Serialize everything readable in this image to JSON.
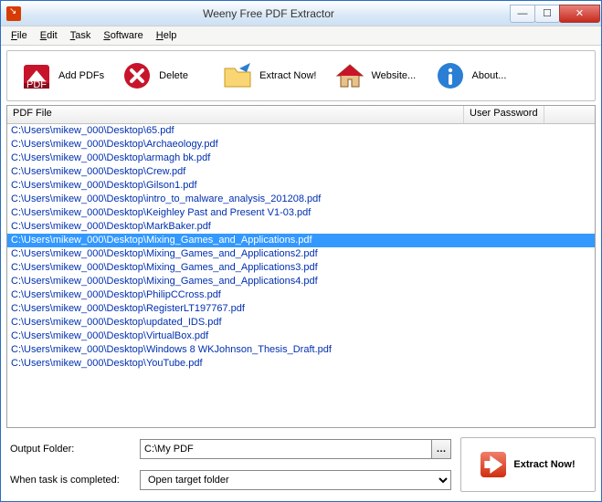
{
  "window": {
    "title": "Weeny Free PDF Extractor"
  },
  "menubar": {
    "file_suffix": "ile",
    "edit_suffix": "dit",
    "task_suffix": "ask",
    "software_suffix": "oftware",
    "help_suffix": "elp"
  },
  "toolbar": {
    "add_pdfs": "Add PDFs",
    "delete": "Delete",
    "extract_now": "Extract Now!",
    "website": "Website...",
    "about": "About..."
  },
  "list": {
    "columns": [
      "PDF File",
      "User Password"
    ],
    "selected_index": 8,
    "rows": [
      "C:\\Users\\mikew_000\\Desktop\\65.pdf",
      "C:\\Users\\mikew_000\\Desktop\\Archaeology.pdf",
      "C:\\Users\\mikew_000\\Desktop\\armagh bk.pdf",
      "C:\\Users\\mikew_000\\Desktop\\Crew.pdf",
      "C:\\Users\\mikew_000\\Desktop\\Gilson1.pdf",
      "C:\\Users\\mikew_000\\Desktop\\intro_to_malware_analysis_201208.pdf",
      "C:\\Users\\mikew_000\\Desktop\\Keighley Past and Present V1-03.pdf",
      "C:\\Users\\mikew_000\\Desktop\\MarkBaker.pdf",
      "C:\\Users\\mikew_000\\Desktop\\Mixing_Games_and_Applications.pdf",
      "C:\\Users\\mikew_000\\Desktop\\Mixing_Games_and_Applications2.pdf",
      "C:\\Users\\mikew_000\\Desktop\\Mixing_Games_and_Applications3.pdf",
      "C:\\Users\\mikew_000\\Desktop\\Mixing_Games_and_Applications4.pdf",
      "C:\\Users\\mikew_000\\Desktop\\PhilipCCross.pdf",
      "C:\\Users\\mikew_000\\Desktop\\RegisterLT197767.pdf",
      "C:\\Users\\mikew_000\\Desktop\\updated_IDS.pdf",
      "C:\\Users\\mikew_000\\Desktop\\VirtualBox.pdf",
      "C:\\Users\\mikew_000\\Desktop\\Windows 8 WKJohnson_Thesis_Draft.pdf",
      "C:\\Users\\mikew_000\\Desktop\\YouTube.pdf"
    ]
  },
  "bottom": {
    "output_folder_label": "Output Folder:",
    "output_folder_value": "C:\\My PDF",
    "when_completed_label": "When task is completed:",
    "when_completed_value": "Open target folder",
    "extract_now_button": "Extract Now!"
  }
}
